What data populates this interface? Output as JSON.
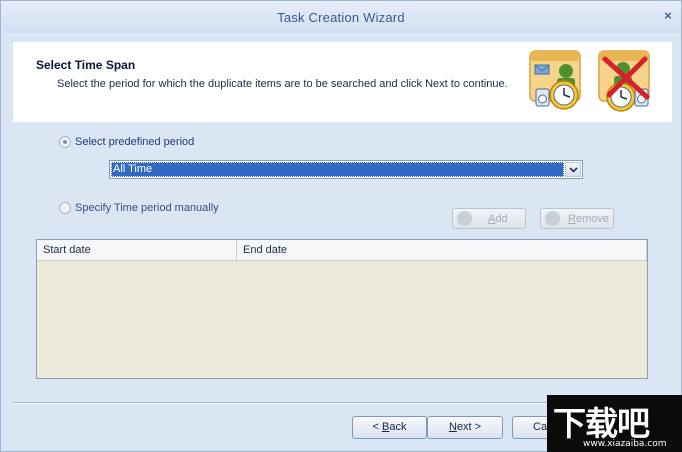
{
  "window": {
    "title": "Task Creation Wizard",
    "close_glyph": "×"
  },
  "header": {
    "title": "Select Time Span",
    "description": "Select the period for which the duplicate items are to be searched and click Next to continue.",
    "icons": [
      "calendar-users-clock-icon",
      "calendar-user-delete-icon"
    ]
  },
  "options": {
    "predefined": {
      "label": "Select predefined period",
      "checked": true
    },
    "period_select": {
      "value": "All Time"
    },
    "manual": {
      "label": "Specify Time period manually",
      "checked": false
    }
  },
  "range_buttons": {
    "add": {
      "label_prefix": "",
      "accel": "A",
      "label_suffix": "dd"
    },
    "remove": {
      "label_prefix": "",
      "accel": "R",
      "label_suffix": "emove"
    }
  },
  "table": {
    "columns": [
      "Start date",
      "End date"
    ],
    "rows": []
  },
  "footer": {
    "back": {
      "prefix": "< ",
      "accel": "B",
      "suffix": "ack"
    },
    "next": {
      "prefix": "",
      "accel": "N",
      "suffix": "ext >"
    },
    "cancel": {
      "label": "Ca"
    }
  },
  "watermark": {
    "text": "下载吧",
    "url": "www.xiazaiba.com"
  },
  "colors": {
    "accent": "#316ac5",
    "window_bg": "#dbe6f4",
    "table_bg": "#ece9d8"
  }
}
